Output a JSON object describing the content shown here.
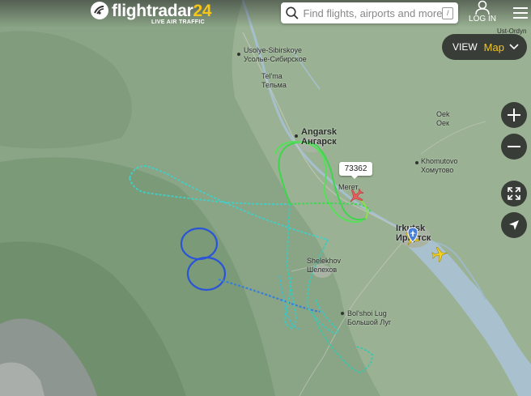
{
  "header": {
    "brand_main": "flightradar",
    "brand_num": "24",
    "brand_sub": "LIVE AIR TRAFFIC",
    "search_placeholder": "Find flights, airports and more",
    "search_key_hint": "/",
    "login_label": "LOG IN"
  },
  "view_control": {
    "label": "VIEW",
    "value": "Map"
  },
  "map": {
    "flight_callout": "73362",
    "edge_label": "Ust-Ordyn",
    "places": [
      {
        "id": "usolye",
        "latin": "Usolye-Sibirskoye",
        "cyr": "Усолье-Сибирское"
      },
      {
        "id": "telma",
        "latin": "Tel'ma",
        "cyr": "Тельма"
      },
      {
        "id": "angarsk",
        "latin": "Angarsk",
        "cyr": "Ангарск"
      },
      {
        "id": "oek",
        "latin": "Oek",
        "cyr": "Оек"
      },
      {
        "id": "khomutovo",
        "latin": "Khomutovo",
        "cyr": "Хомутово"
      },
      {
        "id": "megat",
        "latin": "Мегет"
      },
      {
        "id": "irkutsk",
        "latin": "Irkutsk",
        "cyr": "Иркутск"
      },
      {
        "id": "shelekhov",
        "latin": "Shelekhov",
        "cyr": "Шелехов"
      },
      {
        "id": "bolshoilug",
        "latin": "Bol'shoi Lug",
        "cyr": "Большой Луг"
      }
    ]
  },
  "icons": [
    "search-icon",
    "user-icon",
    "hamburger-menu-icon",
    "chevron-down-icon",
    "zoom-in-icon",
    "zoom-out-icon",
    "fullscreen-icon",
    "locate-arrow-icon",
    "airplane-icon",
    "airport-pin-icon"
  ],
  "colors": {
    "selected_aircraft": "#e85c5c",
    "other_aircraft": "#f7d21c",
    "accent": "#f5c518",
    "track_green": "#39d64a",
    "track_teal": "#36d6b4",
    "track_blue": "#2f5fd4"
  }
}
